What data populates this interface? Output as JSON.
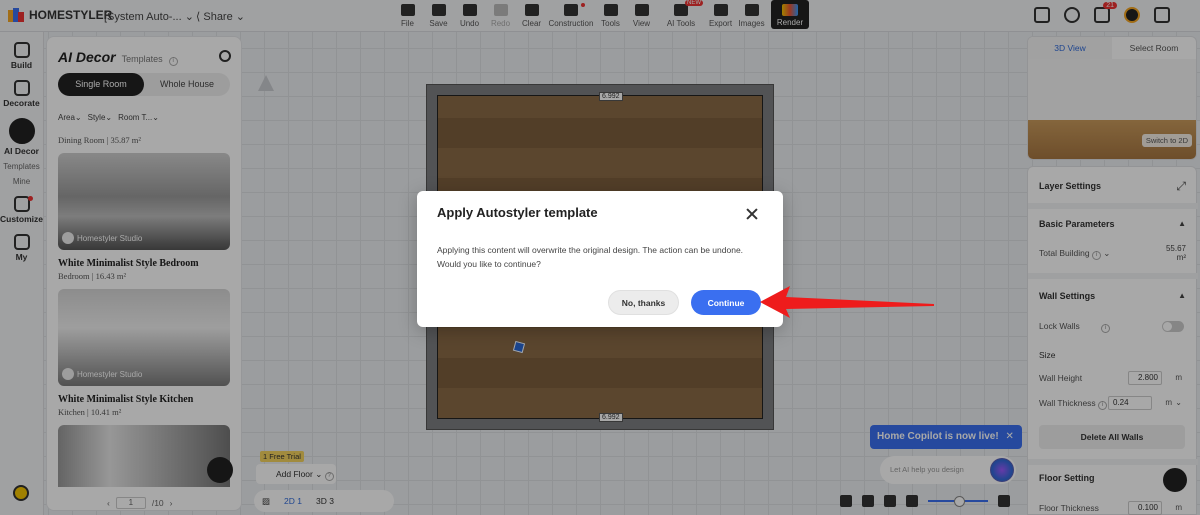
{
  "app": {
    "name": "HOMESTYLER",
    "doc_title": "[System Auto-...",
    "share_label": "Share",
    "notification_count": "21"
  },
  "toolbar": {
    "items": [
      {
        "label": "File",
        "icon": "folder-icon"
      },
      {
        "label": "Save",
        "icon": "save-icon"
      },
      {
        "label": "Undo",
        "icon": "undo-icon"
      },
      {
        "label": "Redo",
        "icon": "redo-icon",
        "disabled": true
      },
      {
        "label": "Clear",
        "icon": "eraser-icon"
      },
      {
        "label": "Construction",
        "icon": "construction-icon"
      },
      {
        "label": "Tools",
        "icon": "tools-icon"
      },
      {
        "label": "View",
        "icon": "eye-icon"
      },
      {
        "label": "AI Tools",
        "icon": "ai-tools-icon",
        "tag": "NEW"
      },
      {
        "label": "Export",
        "icon": "export-icon"
      },
      {
        "label": "Images",
        "icon": "images-icon"
      }
    ],
    "render_label": "Render"
  },
  "rail": {
    "build": "Build",
    "decorate": "Decorate",
    "ai_decor": "AI Decor",
    "templates": "Templates",
    "mine": "Mine",
    "customize": "Customize",
    "my": "My"
  },
  "left_panel": {
    "title": "AI Decor",
    "subtitle": "Templates",
    "tabs": [
      "Single Room",
      "Whole House"
    ],
    "filters": [
      "Area",
      "Style",
      "Room T..."
    ],
    "top_meta": "Dining Room | 35.87 m²",
    "cards": [
      {
        "title": "White Minimalist Style Bedroom",
        "sub": "Bedroom | 16.43 m²",
        "brand": "Homestyler Studio"
      },
      {
        "title": "White Minimalist Style Kitchen",
        "sub": "Kitchen | 10.41 m²",
        "brand": "Homestyler Studio"
      }
    ],
    "pager": {
      "current": "1",
      "total": "/10"
    }
  },
  "canvas": {
    "dim_top": "6.992",
    "dim_bottom": "6.992"
  },
  "modal": {
    "title": "Apply Autostyler template",
    "body": "Applying this content will overwrite the original design. The action can be undone. Would you like to continue?",
    "cancel_label": "No, thanks",
    "confirm_label": "Continue"
  },
  "view3d": {
    "tabs": [
      "3D View",
      "Select Room"
    ],
    "switch_label": "Switch to 2D"
  },
  "right_panel": {
    "layer_settings": "Layer Settings",
    "basic_parameters": "Basic Parameters",
    "total_building_label": "Total Building",
    "total_building_value": "55.67",
    "total_building_unit": "m²",
    "wall_settings": "Wall Settings",
    "lock_walls": "Lock Walls",
    "size": "Size",
    "wall_height_label": "Wall Height",
    "wall_height_value": "2.800",
    "wall_thickness_label": "Wall Thickness",
    "wall_thickness_value": "0.24",
    "unit_m": "m",
    "delete_all_walls": "Delete All Walls",
    "floor_setting": "Floor Setting",
    "floor_thickness_label": "Floor Thickness",
    "floor_thickness_value": "0.100"
  },
  "bottom": {
    "free_trial": "1 Free Trial",
    "add_floor": "Add Floor",
    "view_2d": "2D 1",
    "view_3d": "3D 3"
  },
  "copilot": {
    "banner": "Home Copilot is now live!",
    "placeholder": "Let AI help you design"
  }
}
